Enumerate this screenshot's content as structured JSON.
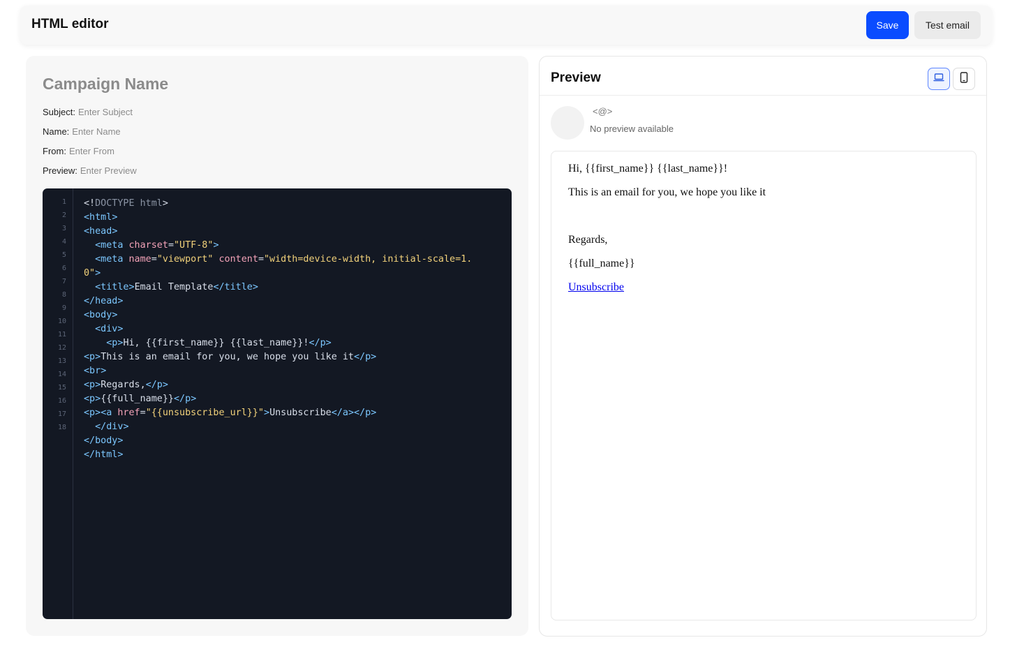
{
  "header": {
    "title": "HTML editor",
    "save_label": "Save",
    "test_email_label": "Test email"
  },
  "campaign": {
    "name_placeholder": "Campaign Name",
    "fields": [
      {
        "label": "Subject:",
        "placeholder": "Enter Subject"
      },
      {
        "label": "Name:",
        "placeholder": "Enter Name"
      },
      {
        "label": "From:",
        "placeholder": "Enter From"
      },
      {
        "label": "Preview:",
        "placeholder": "Enter Preview"
      }
    ]
  },
  "editor": {
    "line_numbers": [
      "1",
      "2",
      "3",
      "4",
      "5",
      "6",
      "7",
      "8",
      "9",
      "10",
      "11",
      "12",
      "13",
      "14",
      "15",
      "16",
      "17",
      "18"
    ],
    "code_lines": [
      "<!DOCTYPE html>",
      "<html>",
      "<head>",
      "  <meta charset=\"UTF-8\">",
      "  <meta name=\"viewport\" content=\"width=device-width, initial-scale=1.",
      "0\">",
      "  <title>Email Template</title>",
      "</head>",
      "<body>",
      "  <div>",
      "    <p>Hi, {{first_name}} {{last_name}}!</p>",
      "<p>This is an email for you, we hope you like it</p>",
      "<br>",
      "<p>Regards,</p>",
      "<p>{{full_name}}</p>",
      "<p><a href=\"{{unsubscribe_url}}\">Unsubscribe</a></p>",
      "  </div>",
      "</body>",
      "</html>"
    ]
  },
  "preview": {
    "title": "Preview",
    "desktop_icon": "laptop-icon",
    "mobile_icon": "phone-icon",
    "sender": "<@>",
    "no_preview": "No preview available",
    "email": {
      "greeting": "Hi, {{first_name}} {{last_name}}!",
      "body": "This is an email for you, we hope you like it",
      "regards": "Regards,",
      "full_name": "{{full_name}}",
      "unsubscribe": "Unsubscribe"
    }
  },
  "colors": {
    "primary": "#0a4cff",
    "editor_bg": "#131823",
    "tag": "#7cc7ff",
    "attr": "#f3a2b8",
    "string": "#f1d17a"
  }
}
